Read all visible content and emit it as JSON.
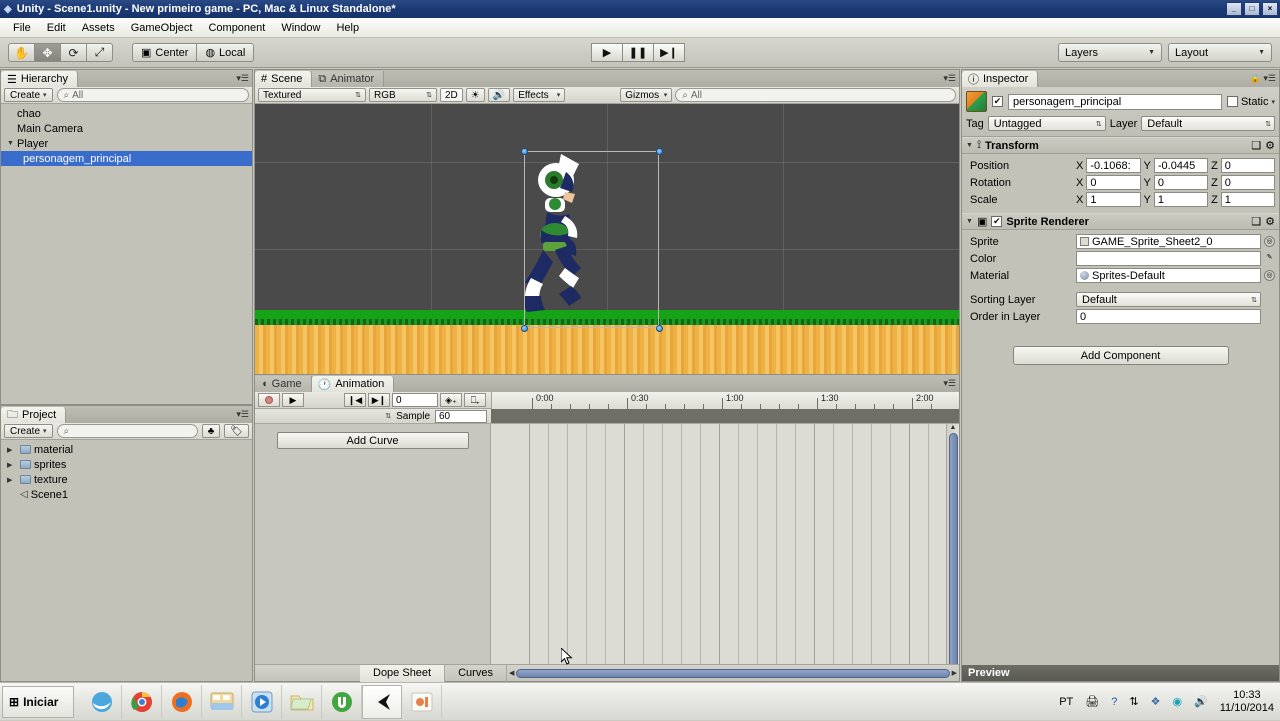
{
  "window": {
    "title": "Unity - Scene1.unity - New primeiro game - PC, Mac & Linux Standalone*",
    "icon": "unity-icon",
    "minimize": "_",
    "maximize": "□",
    "close": "×"
  },
  "menubar": {
    "items": [
      "File",
      "Edit",
      "Assets",
      "GameObject",
      "Component",
      "Window",
      "Help"
    ]
  },
  "toolbar": {
    "transform_tools": [
      {
        "name": "hand-tool",
        "glyph": "✋",
        "selected": false
      },
      {
        "name": "move-tool",
        "glyph": "✥",
        "selected": true
      },
      {
        "name": "rotate-tool",
        "glyph": "⟳",
        "selected": false
      },
      {
        "name": "scale-tool",
        "glyph": "⤢",
        "selected": false
      }
    ],
    "pivot_label": "Center",
    "space_label": "Local",
    "play_label": "▶",
    "pause_label": "❚❚",
    "step_label": "▶❙",
    "layers_label": "Layers",
    "layout_label": "Layout"
  },
  "hierarchy": {
    "tab": "Hierarchy",
    "create_label": "Create",
    "search_placeholder": "All",
    "items": [
      {
        "label": "chao",
        "depth": 0,
        "expandable": false,
        "selected": false
      },
      {
        "label": "Main Camera",
        "depth": 0,
        "expandable": false,
        "selected": false
      },
      {
        "label": "Player",
        "depth": 0,
        "expandable": true,
        "selected": false
      },
      {
        "label": "personagem_principal",
        "depth": 1,
        "expandable": false,
        "selected": true
      }
    ]
  },
  "project": {
    "tab": "Project",
    "create_label": "Create",
    "search_placeholder": "",
    "items": [
      {
        "label": "material",
        "type": "folder"
      },
      {
        "label": "sprites",
        "type": "folder"
      },
      {
        "label": "texture",
        "type": "folder"
      },
      {
        "label": "Scene1",
        "type": "scene"
      }
    ]
  },
  "scene": {
    "tabs": [
      {
        "label": "Scene",
        "icon": "grid-icon",
        "active": true
      },
      {
        "label": "Animator",
        "icon": "animator-icon",
        "active": false
      }
    ],
    "draw_mode": "Textured",
    "color_mode": "RGB",
    "mode_2d": "2D",
    "light_icon": "☀",
    "audio_icon": "🔊",
    "effects_label": "Effects",
    "gizmos_label": "Gizmos",
    "search_placeholder": "All",
    "background_color": "#4a4a4a",
    "grass_color": "#17a317",
    "sand_color": "#eeb143"
  },
  "inspector": {
    "tab": "Inspector",
    "object_name": "personagem_principal",
    "enabled": true,
    "static_label": "Static",
    "tag_label": "Tag",
    "tag_value": "Untagged",
    "layer_label": "Layer",
    "layer_value": "Default",
    "components": [
      {
        "name": "Transform",
        "enabled_checkbox": false,
        "rows": [
          {
            "label": "Position",
            "axes": [
              {
                "axis": "X",
                "value": "-0.1068:"
              },
              {
                "axis": "Y",
                "value": "-0.0445"
              },
              {
                "axis": "Z",
                "value": "0"
              }
            ]
          },
          {
            "label": "Rotation",
            "axes": [
              {
                "axis": "X",
                "value": "0"
              },
              {
                "axis": "Y",
                "value": "0"
              },
              {
                "axis": "Z",
                "value": "0"
              }
            ]
          },
          {
            "label": "Scale",
            "axes": [
              {
                "axis": "X",
                "value": "1"
              },
              {
                "axis": "Y",
                "value": "1"
              },
              {
                "axis": "Z",
                "value": "1"
              }
            ]
          }
        ]
      },
      {
        "name": "Sprite Renderer",
        "enabled_checkbox": true,
        "fields": [
          {
            "label": "Sprite",
            "value": "GAME_Sprite_Sheet2_0",
            "type": "object"
          },
          {
            "label": "Color",
            "value": "",
            "type": "color"
          },
          {
            "label": "Material",
            "value": "Sprites-Default",
            "type": "object"
          },
          {
            "label": "Sorting Layer",
            "value": "Default",
            "type": "popup"
          },
          {
            "label": "Order in Layer",
            "value": "0",
            "type": "number"
          }
        ]
      }
    ],
    "add_component_label": "Add Component",
    "preview_label": "Preview"
  },
  "animation": {
    "tabs": [
      {
        "label": "Game",
        "icon": "game-icon",
        "active": false
      },
      {
        "label": "Animation",
        "icon": "clock-icon",
        "active": true
      }
    ],
    "record_icon": "record-icon",
    "play_icon": "▶",
    "prev_key_icon": "❙◀",
    "next_key_icon": "▶❙",
    "frame_value": "0",
    "add_keyframe_icon": "◈₊",
    "add_event_icon": "⎕₊",
    "sample_label": "Sample",
    "sample_value": "60",
    "add_curve_label": "Add Curve",
    "timeline_labels": [
      "0:00",
      "0:30",
      "1:00",
      "1:30",
      "2:00"
    ],
    "bottom_tabs": [
      {
        "label": "Dope Sheet",
        "active": true
      },
      {
        "label": "Curves",
        "active": false
      }
    ]
  },
  "taskbar": {
    "start_label": "Iniciar",
    "apps": [
      {
        "name": "internet-explorer-icon",
        "active": false
      },
      {
        "name": "chrome-icon",
        "active": false
      },
      {
        "name": "firefox-icon",
        "active": false
      },
      {
        "name": "file-explorer-icon",
        "active": false
      },
      {
        "name": "media-player-icon",
        "active": false
      },
      {
        "name": "folder-icon",
        "active": false
      },
      {
        "name": "utorrent-icon",
        "active": false
      },
      {
        "name": "unity-icon",
        "active": true
      },
      {
        "name": "app-icon",
        "active": false
      }
    ],
    "language": "PT",
    "time": "10:33",
    "date": "11/10/2014"
  }
}
